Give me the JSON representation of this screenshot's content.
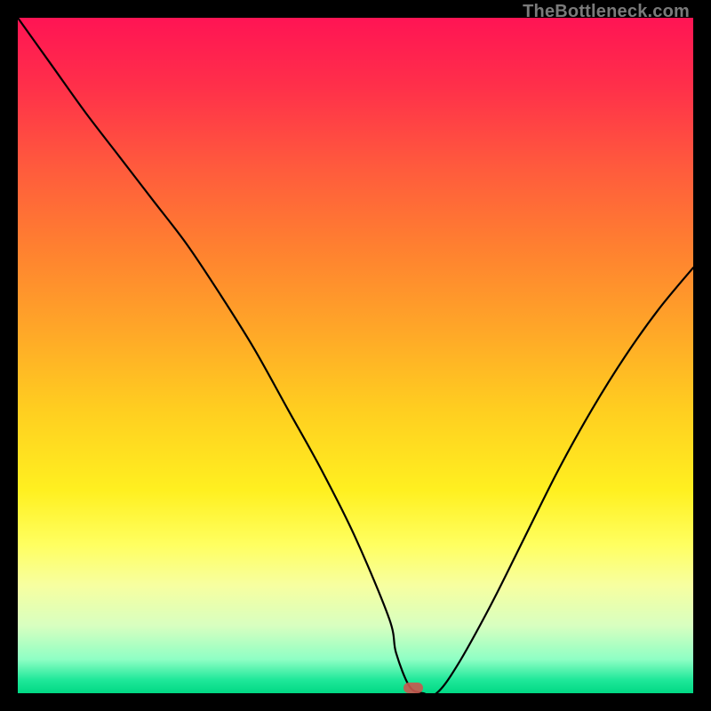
{
  "watermark": "TheBottleneck.com",
  "marker": {
    "x_frac": 0.585,
    "y_frac": 0.995
  },
  "chart_data": {
    "type": "line",
    "title": "",
    "xlabel": "",
    "ylabel": "",
    "xlim": [
      0,
      100
    ],
    "ylim": [
      0,
      100
    ],
    "series": [
      {
        "name": "bottleneck-curve",
        "x": [
          0,
          5,
          10,
          15,
          20,
          25,
          30,
          35,
          40,
          45,
          50,
          55,
          56,
          58,
          60,
          62,
          65,
          70,
          75,
          80,
          85,
          90,
          95,
          100
        ],
        "y": [
          100,
          93,
          86,
          79.5,
          73,
          66.5,
          59,
          51,
          42,
          33,
          23,
          11,
          6,
          1,
          0,
          0,
          4,
          13,
          23,
          33,
          42,
          50,
          57,
          63
        ]
      }
    ],
    "marker_point": {
      "x": 60,
      "y": 0
    }
  }
}
